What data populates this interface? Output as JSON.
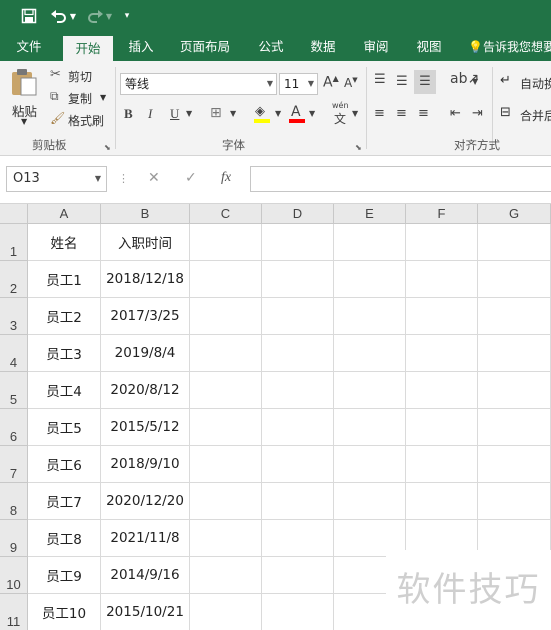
{
  "tabs": [
    "文件",
    "开始",
    "插入",
    "页面布局",
    "公式",
    "数据",
    "审阅",
    "视图"
  ],
  "tell_me": "告诉我您想要",
  "clipboard": {
    "paste": "粘贴",
    "cut": "剪切",
    "copy": "复制",
    "format_painter": "格式刷",
    "group": "剪贴板"
  },
  "font": {
    "name": "等线",
    "size": "11",
    "group": "字体",
    "bold": "B",
    "italic": "I",
    "underline": "U",
    "wen": "wén",
    "wen_char": "文",
    "fill_color": "#ffff00",
    "font_color": "#ff0000"
  },
  "alignment": {
    "wrap": "自动换",
    "merge": "合并后",
    "group": "对齐方式"
  },
  "name_box": "O13",
  "formula_value": "",
  "columns": [
    "A",
    "B",
    "C",
    "D",
    "E",
    "F",
    "G"
  ],
  "rows": [
    [
      "姓名",
      "入职时间"
    ],
    [
      "员工1",
      "2018/12/18"
    ],
    [
      "员工2",
      "2017/3/25"
    ],
    [
      "员工3",
      "2019/8/4"
    ],
    [
      "员工4",
      "2020/8/12"
    ],
    [
      "员工5",
      "2015/5/12"
    ],
    [
      "员工6",
      "2018/9/10"
    ],
    [
      "员工7",
      "2020/12/20"
    ],
    [
      "员工8",
      "2021/11/8"
    ],
    [
      "员工9",
      "2014/9/16"
    ],
    [
      "员工10",
      "2015/10/21"
    ]
  ],
  "watermark": "软件技巧",
  "colors": {
    "excel_green": "#217346",
    "ribbon_bg": "#f3f3f3"
  }
}
